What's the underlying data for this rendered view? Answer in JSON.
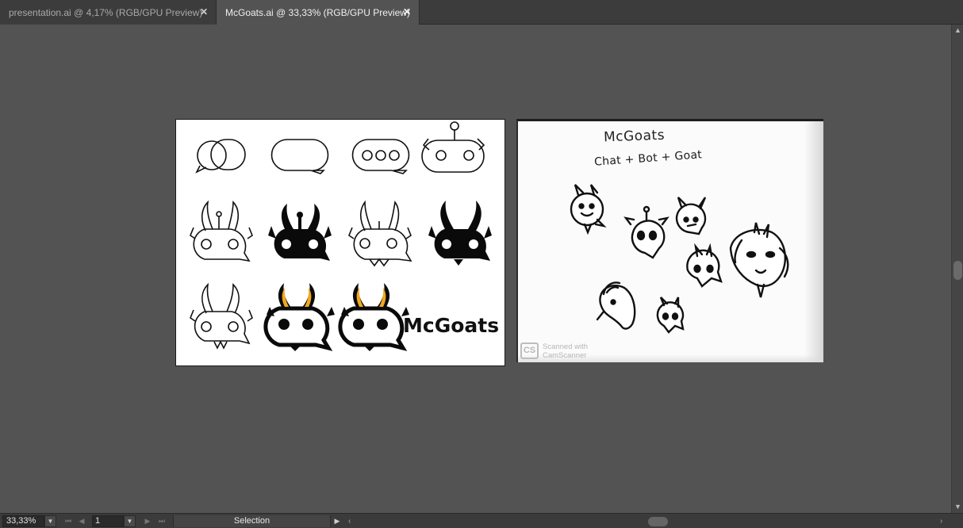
{
  "tabs": [
    {
      "label": "presentation.ai @ 4,17% (RGB/GPU Preview)",
      "close": "✕",
      "active": false
    },
    {
      "label": "McGoats.ai @ 33,33% (RGB/GPU Preview)",
      "close": "✕",
      "active": true
    }
  ],
  "artboard_logo": {
    "wordmark": "McGoats",
    "accent_color": "#f0a81c"
  },
  "artboard_sketch": {
    "title": "McGoats",
    "subtitle": "Chat + Bot + Goat",
    "scanner_badge": "CS",
    "scanner_text_line1": "Scanned with",
    "scanner_text_line2": "CamScanner"
  },
  "statusbar": {
    "zoom": "33,33%",
    "zoom_dropdown_icon": "chevron-down-icon",
    "page_number": "1",
    "tool": "Selection",
    "nav_icons": [
      "first-page-icon",
      "prev-page-icon",
      "next-page-icon",
      "last-page-icon"
    ]
  },
  "colors": {
    "canvas_bg": "#535353",
    "tabbar_bg": "#3c3c3c",
    "active_tab_bg": "#535353",
    "statusbar_bg": "#3b3b3b"
  }
}
